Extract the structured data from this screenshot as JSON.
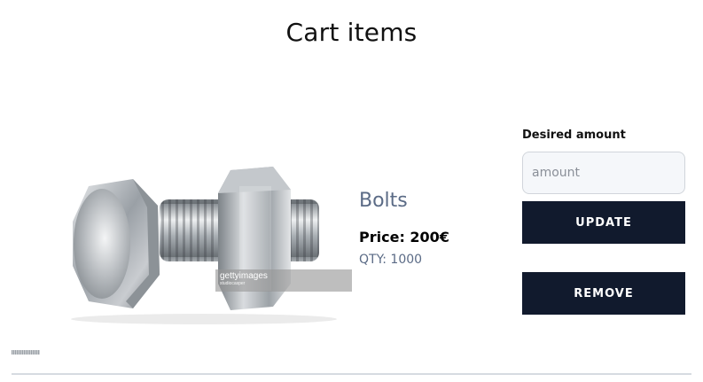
{
  "page": {
    "title": "Cart items"
  },
  "item": {
    "image": {
      "alt": "Bolts",
      "watermark": {
        "brand": "gettyimages",
        "credit": "studiocasper"
      }
    },
    "name": "Bolts",
    "price_text": "Price: 200€",
    "qty_text": "QTY: 1000",
    "amount": {
      "label": "Desired amount",
      "placeholder": "amount",
      "value": ""
    },
    "update_label": "UPDATE",
    "remove_label": "REMOVE"
  },
  "colors": {
    "button_bg": "#111a2d",
    "muted_text": "#5b6b86",
    "input_bg": "#f5f7fa",
    "divider": "#d6dbe1"
  }
}
